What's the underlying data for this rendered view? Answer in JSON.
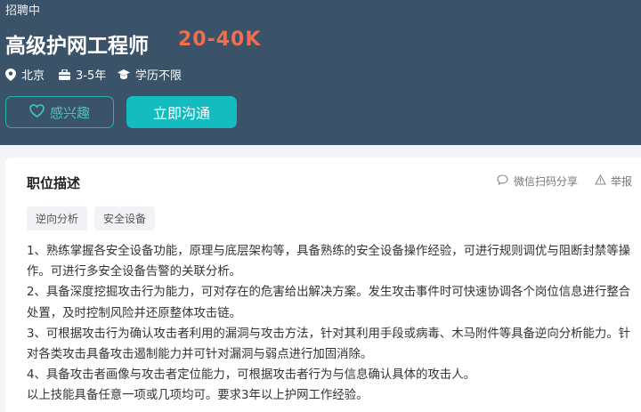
{
  "header": {
    "status": "招聘中",
    "title": "高级护网工程师",
    "salary": "20-40K",
    "location": "北京",
    "experience": "3-5年",
    "education": "学历不限",
    "accent_color": "#14bcc0",
    "salary_color": "#f26d4f"
  },
  "actions": {
    "interested_label": "感兴趣",
    "chat_label": "立即沟通"
  },
  "job": {
    "section_title": "职位描述",
    "share_label": "微信扫码分享",
    "report_label": "举报",
    "tags": [
      "逆向分析",
      "安全设备"
    ],
    "description": [
      "1、熟练掌握各安全设备功能，原理与底层架构等，具备熟练的安全设备操作经验，可进行规则调优与阻断封禁等操作。可进行多安全设备告警的关联分析。",
      "2、具备深度挖掘攻击行为能力，可对存在的危害给出解决方案。发生攻击事件时可快速协调各个岗位信息进行整合处置，及时控制风险并还原整体攻击链。",
      "3、可根据攻击行为确认攻击者利用的漏洞与攻击方法，针对其利用手段或病毒、木马附件等具备逆向分析能力。针对各类攻击具备攻击遏制能力并可针对漏洞与弱点进行加固消除。",
      "4、具备攻击者画像与攻击者定位能力，可根据攻击者行为与信息确认具体的攻击人。",
      "以上技能具备任意一项或几项均可。要求3年以上护网工作经验。"
    ]
  }
}
